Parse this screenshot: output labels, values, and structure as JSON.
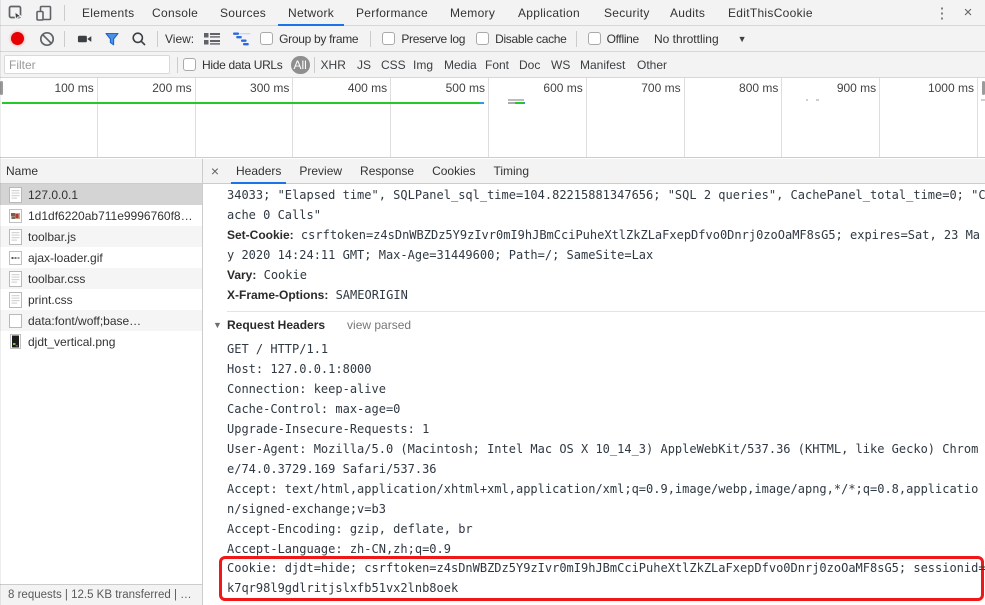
{
  "window": {
    "title": "Chrome DevTools - Network panel",
    "kebab_icon": "⋮",
    "close_icon": "×",
    "accent_blue": "#1a73e8",
    "record_red": "#e60000",
    "overview_green": "#26c826",
    "overview_blue": "#3397f2",
    "highlight_red": "#ef1717"
  },
  "main_tabs": [
    {
      "label": "Elements",
      "selected": false
    },
    {
      "label": "Console",
      "selected": false
    },
    {
      "label": "Sources",
      "selected": false
    },
    {
      "label": "Network",
      "selected": true
    },
    {
      "label": "Performance",
      "selected": false
    },
    {
      "label": "Memory",
      "selected": false
    },
    {
      "label": "Application",
      "selected": false
    },
    {
      "label": "Security",
      "selected": false
    },
    {
      "label": "Audits",
      "selected": false
    },
    {
      "label": "EditThisCookie",
      "selected": false
    }
  ],
  "toolbar": {
    "view_label": "View:",
    "group_by_frame": {
      "label": "Group by frame",
      "checked": false
    },
    "preserve_log": {
      "label": "Preserve log",
      "checked": false
    },
    "disable_cache": {
      "label": "Disable cache",
      "checked": false
    },
    "offline": {
      "label": "Offline",
      "checked": false
    },
    "throttling": {
      "value": "No throttling",
      "arrow": "▼"
    }
  },
  "filter": {
    "placeholder": "Filter",
    "value": "",
    "hide_data_urls": {
      "label": "Hide data URLs",
      "checked": false
    },
    "pills": [
      "All",
      "XHR",
      "JS",
      "CSS",
      "Img",
      "Media",
      "Font",
      "Doc",
      "WS",
      "Manifest",
      "Other"
    ],
    "selected_pill": "All"
  },
  "overview": {
    "ticks": [
      "100 ms",
      "200 ms",
      "300 ms",
      "400 ms",
      "500 ms",
      "600 ms",
      "700 ms",
      "800 ms",
      "900 ms",
      "1000 ms"
    ]
  },
  "requests": {
    "column_header": "Name",
    "rows": [
      {
        "name": "127.0.0.1",
        "icon": "document",
        "selected": true
      },
      {
        "name": "1d1df6220ab711e9996760f8…",
        "icon": "image-photo",
        "selected": false
      },
      {
        "name": "toolbar.js",
        "icon": "document",
        "selected": false
      },
      {
        "name": "ajax-loader.gif",
        "icon": "image-loader",
        "selected": false
      },
      {
        "name": "toolbar.css",
        "icon": "document",
        "selected": false
      },
      {
        "name": "print.css",
        "icon": "document",
        "selected": false
      },
      {
        "name": "data:font/woff;base…",
        "icon": "blank",
        "selected": false
      },
      {
        "name": "djdt_vertical.png",
        "icon": "image-djdt",
        "selected": false
      }
    ],
    "summary": "8 requests | 12.5 KB transferred | …"
  },
  "details": {
    "close_icon": "×",
    "tabs": [
      {
        "label": "Headers",
        "selected": true
      },
      {
        "label": "Preview",
        "selected": false
      },
      {
        "label": "Response",
        "selected": false
      },
      {
        "label": "Cookies",
        "selected": false
      },
      {
        "label": "Timing",
        "selected": false
      }
    ],
    "response_headers_partial": [
      "34033; \"Elapsed time\", SQLPanel_sql_time=104.82215881347656; \"SQL 2 queries\", CachePanel_total_time=0; \"C",
      "ache 0 Calls\""
    ],
    "response_headers": [
      {
        "name": "Set-Cookie:",
        "value_lines": [
          "csrftoken=z4sDnWBZDz5Y9zIvr0mI9hJBmCciPuheXtlZkZLaFxepDfvo0Dnrj0zoOaMF8sG5; expires=Sat, 23 Ma",
          "y 2020 14:24:11 GMT; Max-Age=31449600; Path=/; SameSite=Lax"
        ]
      },
      {
        "name": "Vary:",
        "value_lines": [
          "Cookie"
        ]
      },
      {
        "name": "X-Frame-Options:",
        "value_lines": [
          "SAMEORIGIN"
        ]
      }
    ],
    "request_headers_section": {
      "disclosure_icon": "▼",
      "title": "Request Headers",
      "action_link": "view parsed"
    },
    "raw_request_lines": [
      "GET / HTTP/1.1",
      "Host: 127.0.0.1:8000",
      "Connection: keep-alive",
      "Cache-Control: max-age=0",
      "Upgrade-Insecure-Requests: 1",
      "User-Agent: Mozilla/5.0 (Macintosh; Intel Mac OS X 10_14_3) AppleWebKit/537.36 (KHTML, like Gecko) Chrom",
      "e/74.0.3729.169 Safari/537.36",
      "Accept: text/html,application/xhtml+xml,application/xml;q=0.9,image/webp,image/apng,*/*;q=0.8,applicatio",
      "n/signed-exchange;v=b3",
      "Accept-Encoding: gzip, deflate, br",
      "Accept-Language: zh-CN,zh;q=0.9"
    ],
    "highlighted_lines": [
      "Cookie: djdt=hide; csrftoken=z4sDnWBZDz5Y9zIvr0mI9hJBmCciPuheXtlZkZLaFxepDfvo0Dnrj0zoOaMF8sG5; sessionid=",
      "k7qr98l9gdlritjslxfb51vx2lnb8oek"
    ]
  }
}
